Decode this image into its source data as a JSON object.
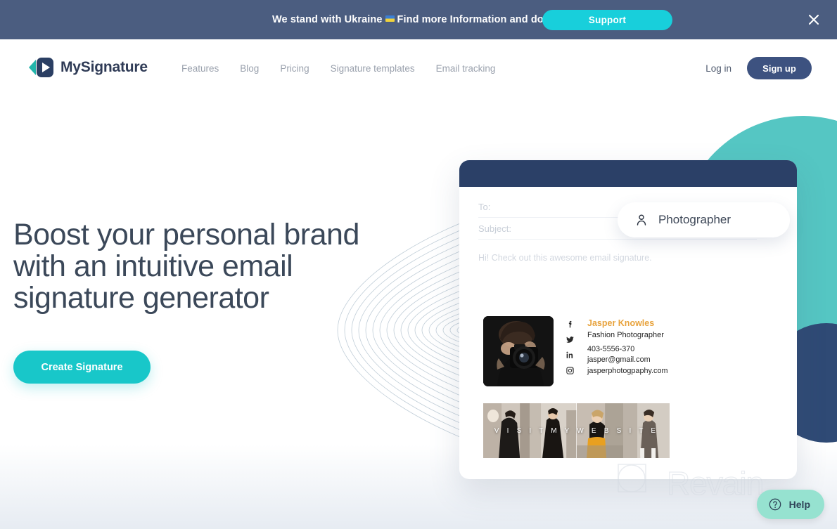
{
  "banner": {
    "text_before": "We stand with Ukraine",
    "flag_icon": "ukraine-flag-icon",
    "text_after": "Find more Information and donate",
    "support_label": "Support",
    "close_icon": "close-icon",
    "background_color": "#4b5d80",
    "support_color": "#18cfdb"
  },
  "header": {
    "logo_text": "MySignature",
    "logo_icon": "mysignature-logo-icon",
    "nav": [
      {
        "label": "Features"
      },
      {
        "label": "Blog"
      },
      {
        "label": "Pricing"
      },
      {
        "label": "Signature templates"
      },
      {
        "label": "Email tracking"
      }
    ],
    "login_label": "Log in",
    "signup_label": "Sign up",
    "signup_color": "#3d5280"
  },
  "hero": {
    "title": "Boost your personal brand with an intuitive email signature generator",
    "cta_label": "Create Signature",
    "cta_color": "#18c7c9",
    "deco_teal_color": "#55c6c3",
    "deco_navy_color": "#2f4a75"
  },
  "mail_mock": {
    "to_label": "To:",
    "subject_label": "Subject:",
    "body_text": "Hi! Check out this awesome email signature.",
    "header_color": "#2b4067",
    "signature": {
      "photo_icon": "photographer-portrait-image",
      "name": "Jasper Knowles",
      "name_color": "#e8a33d",
      "role": "Fashion Photographer",
      "phone": "403-5556-370",
      "email": "jasper@gmail.com",
      "website": "jasperphotogpaphy.com",
      "social_icons": [
        "facebook-icon",
        "twitter-icon",
        "linkedin-icon",
        "instagram-icon"
      ],
      "banner_label": "V I S I T   M Y   W E B S I T E"
    }
  },
  "photographer_pill": {
    "icon": "person-icon",
    "label": "Photographer"
  },
  "watermark": {
    "text": "Revain",
    "icon": "revain-logo-icon"
  },
  "help_widget": {
    "icon": "question-circle-icon",
    "label": "Help",
    "background_color": "#96e2d0"
  }
}
